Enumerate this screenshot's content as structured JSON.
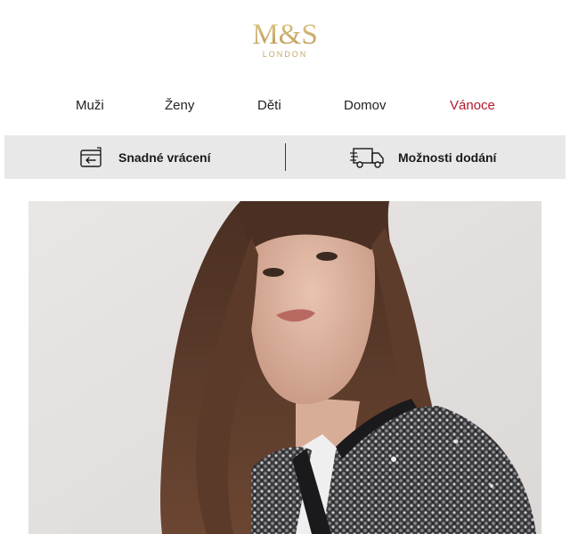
{
  "brand": {
    "logo_text": "M&S",
    "logo_subtext": "LONDON",
    "gold_color": "#c7a862"
  },
  "nav": {
    "items": [
      {
        "label": "Muži"
      },
      {
        "label": "Ženy"
      },
      {
        "label": "Děti"
      },
      {
        "label": "Domov"
      },
      {
        "label": "Vánoce",
        "color": "#b3182b"
      }
    ]
  },
  "services": {
    "returns": {
      "label": "Snadné vrácení",
      "icon": "return-box-icon"
    },
    "delivery": {
      "label": "Možnosti dodání",
      "icon": "delivery-truck-icon"
    }
  },
  "hero": {
    "image": "woman-in-sequin-jacket"
  }
}
